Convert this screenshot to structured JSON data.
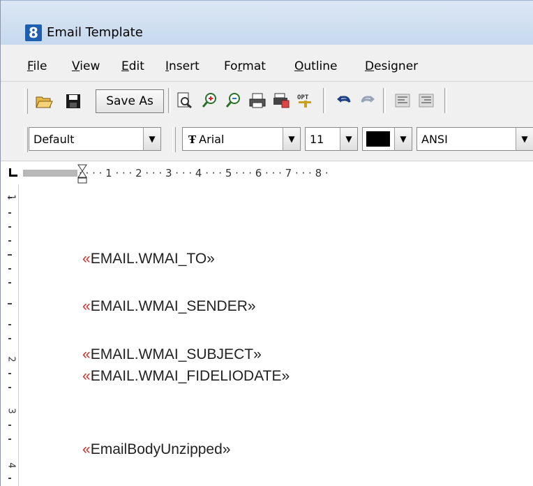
{
  "window": {
    "title": "Email Template",
    "icon": "8"
  },
  "menu": [
    {
      "label": "File",
      "underline": "F",
      "rest": "ile"
    },
    {
      "label": "View",
      "underline": "V",
      "rest": "iew"
    },
    {
      "label": "Edit",
      "underline": "E",
      "rest": "dit"
    },
    {
      "label": "Insert",
      "underline": "I",
      "rest": "nsert"
    },
    {
      "label": "Format",
      "pre": "Fo",
      "underline": "r",
      "rest": "mat"
    },
    {
      "label": "Outline",
      "underline": "O",
      "rest": "utline"
    },
    {
      "label": "Designer",
      "underline": "D",
      "rest": "esigner"
    }
  ],
  "toolbar": {
    "save_as_label": "Save As",
    "icons": [
      "open-folder-icon",
      "save-disk-icon",
      "print-preview-icon",
      "zoom-in-icon",
      "zoom-out-icon",
      "print-icon",
      "print-setup-icon",
      "options-icon",
      "undo-icon",
      "redo-icon",
      "align-left-icon",
      "align-right-icon"
    ]
  },
  "format_bar": {
    "style": "Default",
    "font": "Arial",
    "size": "11",
    "charset": "ANSI",
    "color": "#000000"
  },
  "ruler": {
    "marks": "· · · · 1 · · · 2 · · · 3 · · · 4 · · · 5 · · · 6 · · · 7 · · · 8 ·"
  },
  "vertical_ruler": {
    "numbers": [
      "1",
      "2",
      "3",
      "4"
    ]
  },
  "document": {
    "fields": [
      {
        "open": "«",
        "text": "EMAIL.WMAI_TO",
        "close": "»"
      },
      {
        "open": "«",
        "text": "EMAIL.WMAI_SENDER",
        "close": "»"
      },
      {
        "open": "«",
        "text": "EMAIL.WMAI_SUBJECT",
        "close": "»"
      },
      {
        "open": "«",
        "text": "EMAIL.WMAI_FIDELIODATE",
        "close": "»"
      },
      {
        "open": "«",
        "text": "EmailBodyUnzipped",
        "close": "»"
      }
    ]
  },
  "colors": {
    "field_marker": "#d4312e",
    "title_bar": "#c7d9ee",
    "app_icon": "#1f5fb0"
  }
}
